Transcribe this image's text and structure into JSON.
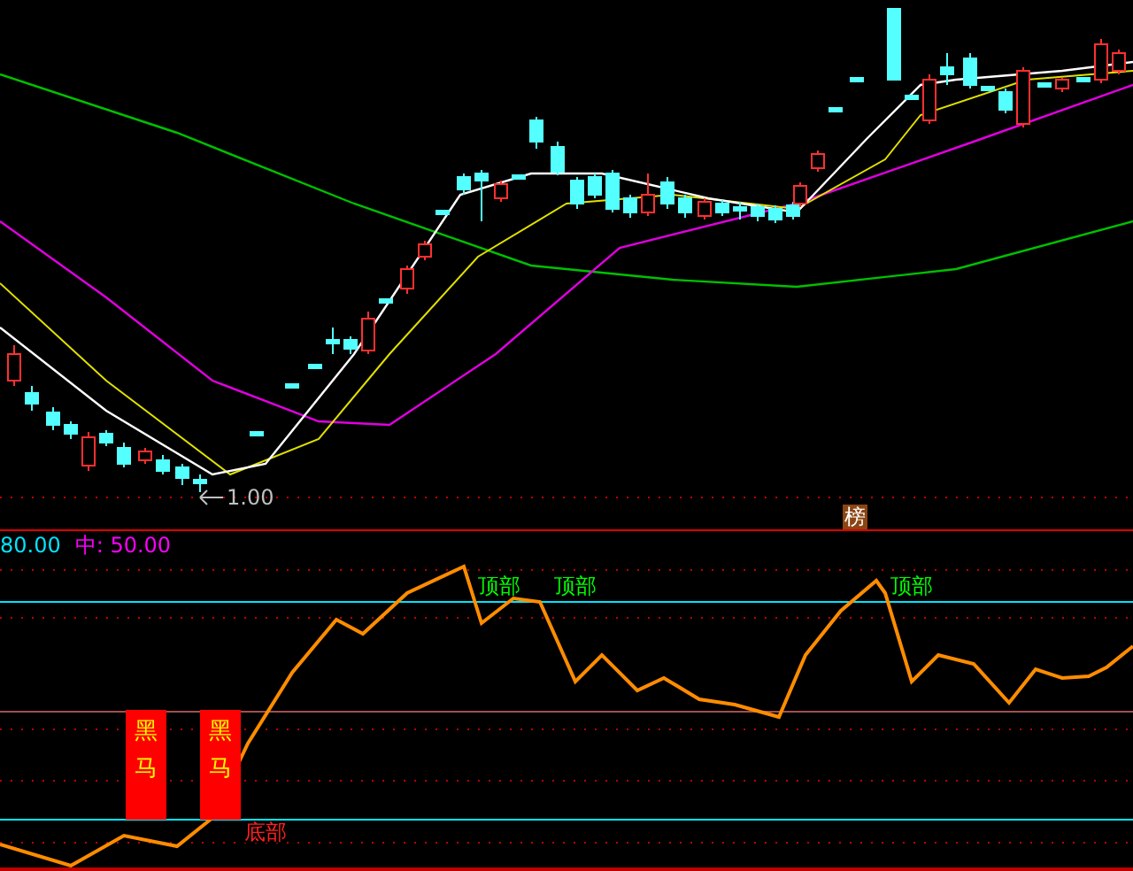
{
  "price_panel": {
    "low_marker": "1.00",
    "badge": "榜"
  },
  "indicator_panel": {
    "legend": [
      {
        "text": "80.00",
        "color": "#00e5ff"
      },
      {
        "text": "中: 50.00",
        "color": "#ff00ff"
      }
    ],
    "signals": [
      {
        "kind": "top",
        "text": "顶部"
      },
      {
        "kind": "top",
        "text": "顶部"
      },
      {
        "kind": "top",
        "text": "顶部"
      },
      {
        "kind": "bottom",
        "text": "底部"
      }
    ],
    "markers": [
      {
        "text": "黑马"
      },
      {
        "text": "黑马"
      }
    ]
  }
}
